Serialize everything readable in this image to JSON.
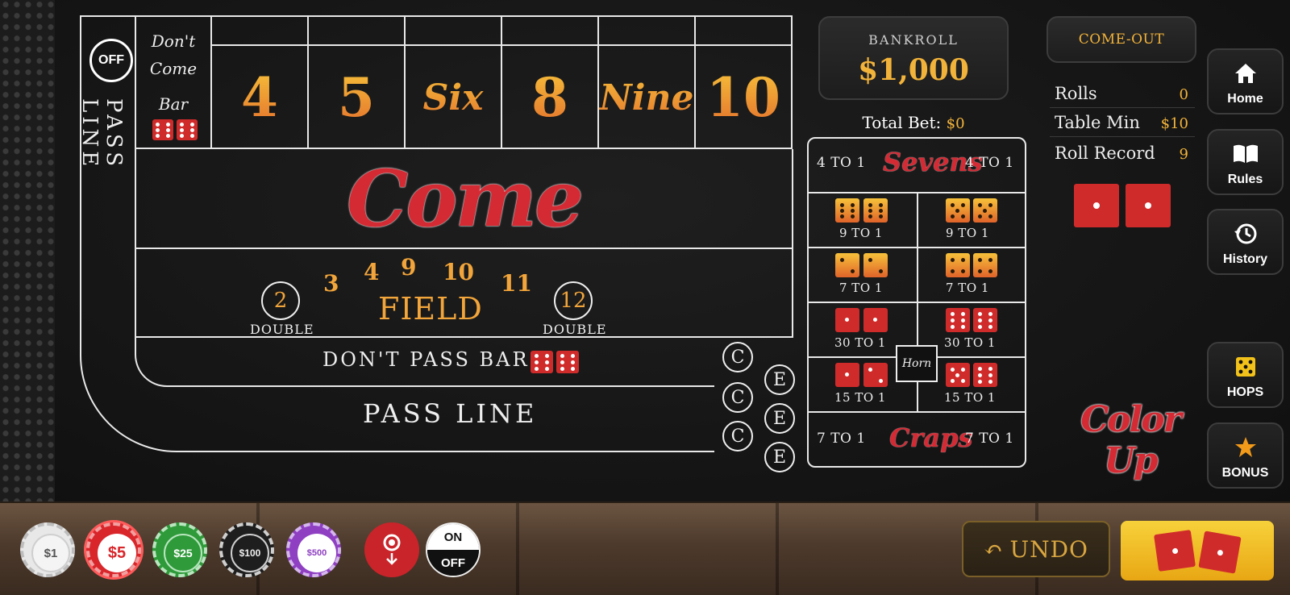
{
  "bankroll": {
    "label": "BANKROLL",
    "amount": "$1,000"
  },
  "total_bet": {
    "label": "Total Bet:",
    "value": "$0"
  },
  "phase": {
    "label": "COME-OUT"
  },
  "stats": [
    {
      "label": "Rolls",
      "value": "0"
    },
    {
      "label": "Table Min",
      "value": "$10"
    },
    {
      "label": "Roll Record",
      "value": "9"
    }
  ],
  "nav": [
    {
      "label": "Home",
      "icon": "home-icon"
    },
    {
      "label": "Rules",
      "icon": "book-icon"
    },
    {
      "label": "History",
      "icon": "history-icon"
    },
    {
      "label": "HOPS",
      "icon": "dice-icon"
    },
    {
      "label": "BONUS",
      "icon": "star-icon"
    }
  ],
  "table": {
    "puck": "OFF",
    "pass_line_side": "PASS LINE",
    "dont_come_bar": [
      "Don't",
      "Come",
      "Bar"
    ],
    "numbers": [
      "4",
      "5",
      "Six",
      "8",
      "Nine",
      "10"
    ],
    "come": "Come",
    "field": {
      "label": "FIELD",
      "numbers": [
        "3",
        "4",
        "9",
        "10",
        "11"
      ],
      "doubles": [
        "2",
        "12"
      ],
      "double_label": "DOUBLE"
    },
    "dont_pass_bar": "DON'T PASS BAR",
    "pass_line": "PASS LINE",
    "c_label": "C",
    "e_label": "E"
  },
  "props": {
    "sevens": {
      "label": "Sevens",
      "odds": "4 TO 1"
    },
    "hardways": [
      {
        "odds": "9 TO 1"
      },
      {
        "odds": "9 TO 1"
      },
      {
        "odds": "7 TO 1"
      },
      {
        "odds": "7 TO 1"
      }
    ],
    "horn_bets": [
      {
        "odds": "30 TO 1"
      },
      {
        "odds": "30 TO 1"
      },
      {
        "odds": "15 TO 1"
      },
      {
        "odds": "15 TO 1"
      }
    ],
    "horn": "Horn",
    "craps": {
      "label": "Craps",
      "odds": "7 TO 1"
    }
  },
  "color_up": "Color Up",
  "chips": [
    {
      "label": "$1",
      "color": "#e8e8e8"
    },
    {
      "label": "$5",
      "color": "#d8262b"
    },
    {
      "label": "$25",
      "color": "#2f9a3a"
    },
    {
      "label": "$100",
      "color": "#1e1e1e"
    },
    {
      "label": "$500",
      "color": "#8e3fc2"
    }
  ],
  "toggle": {
    "on": "ON",
    "off": "OFF"
  },
  "undo": "UNDO",
  "colors": {
    "accent": "#f2b33a",
    "red": "#d42a34"
  }
}
